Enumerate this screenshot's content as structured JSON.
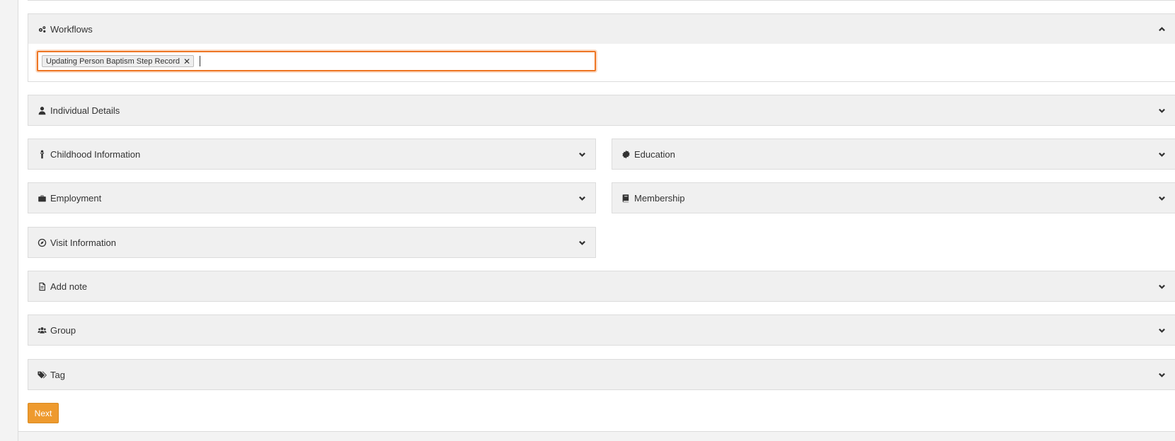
{
  "workflows": {
    "title": "Workflows",
    "chip_label": "Updating Person Baptism Step Record",
    "chip_remove": "✕"
  },
  "sections": {
    "individual_details": "Individual Details",
    "childhood_information": "Childhood Information",
    "education": "Education",
    "employment": "Employment",
    "membership": "Membership",
    "visit_information": "Visit Information",
    "add_note": "Add note",
    "group": "Group",
    "tag": "Tag"
  },
  "next_button": "Next",
  "colors": {
    "accent": "#ee7624",
    "button": "#ee9a2e",
    "header_bg": "#f0f0f0"
  }
}
